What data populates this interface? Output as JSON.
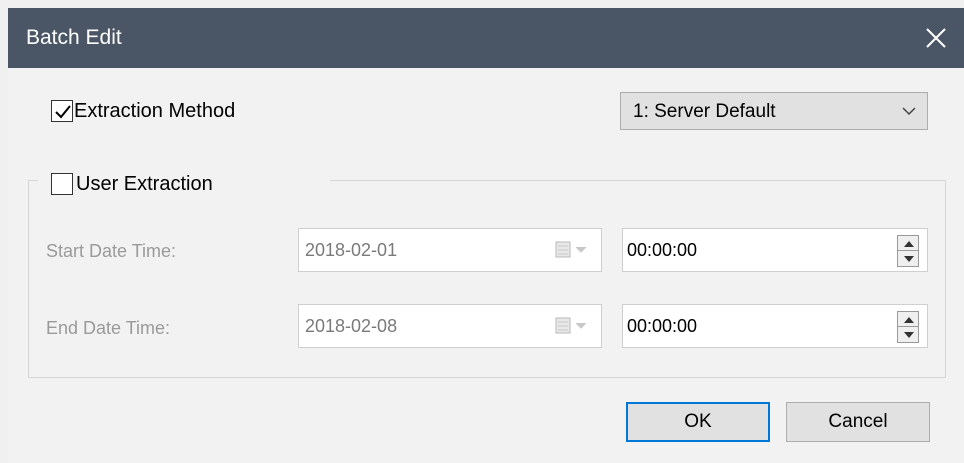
{
  "window": {
    "title": "Batch Edit",
    "close_icon": "close-icon"
  },
  "extraction_method": {
    "label": "Extraction Method",
    "checked": true,
    "selected_option": "1: Server Default"
  },
  "user_extraction": {
    "label": "User Extraction",
    "checked": false,
    "start": {
      "label": "Start Date Time:",
      "date": "2018-02-01",
      "time": "00:00:00"
    },
    "end": {
      "label": "End Date Time:",
      "date": "2018-02-08",
      "time": "00:00:00"
    }
  },
  "buttons": {
    "ok": "OK",
    "cancel": "Cancel"
  },
  "colors": {
    "titlebar": "#4a5666",
    "default_button_border": "#0078d7"
  }
}
